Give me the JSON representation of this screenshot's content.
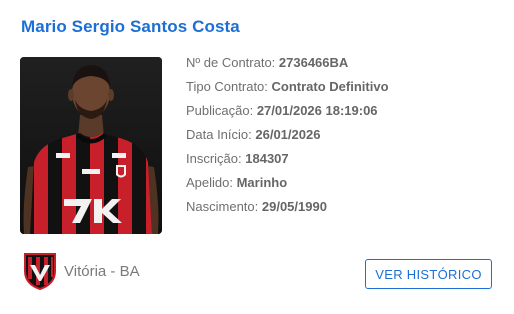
{
  "player": {
    "name": "Mario Sergio Santos Costa",
    "photo_icon": "player-photo"
  },
  "contract": {
    "number_label": "Nº de Contrato: ",
    "number_value": "2736466BA",
    "type_label": "Tipo Contrato: ",
    "type_value": "Contrato Definitivo",
    "publication_label": "Publicação: ",
    "publication_value": "27/01/2026 18:19:06",
    "start_label": "Data Início: ",
    "start_value": "26/01/2026",
    "registration_label": "Inscrição: ",
    "registration_value": "184307",
    "nickname_label": "Apelido: ",
    "nickname_value": "Marinho",
    "birth_label": "Nascimento: ",
    "birth_value": "29/05/1990"
  },
  "club": {
    "name": "Vitória - BA",
    "crest_icon": "club-crest"
  },
  "actions": {
    "history_label": "VER HISTÓRICO"
  },
  "colors": {
    "accent": "#1c6fd6",
    "jersey_red": "#c8202a",
    "jersey_black": "#111111"
  }
}
